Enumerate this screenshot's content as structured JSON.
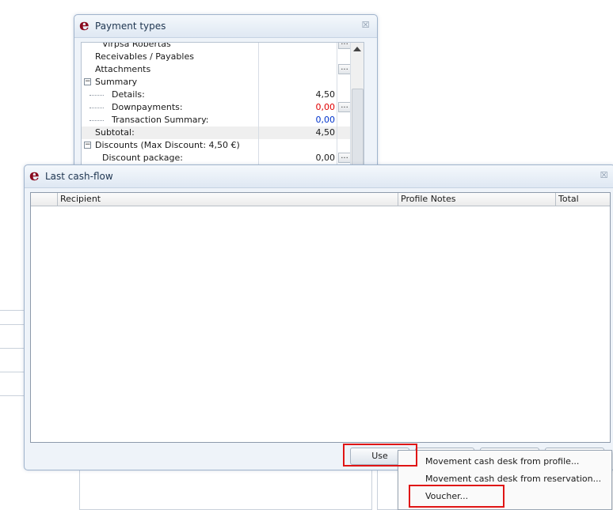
{
  "payment_window": {
    "title": "Payment types",
    "rows": [
      {
        "label": "Virpša Robertas",
        "value": "",
        "ellipsis": true
      },
      {
        "label": "Receivables / Payables",
        "value": "",
        "ellipsis": false
      },
      {
        "label": "Attachments",
        "value": "",
        "ellipsis": true
      },
      {
        "label": "Summary",
        "value": "",
        "ellipsis": false
      },
      {
        "label": "Details:",
        "value": "4,50",
        "ellipsis": false
      },
      {
        "label": "Downpayments:",
        "value": "0,00",
        "ellipsis": true,
        "color": "#e00000"
      },
      {
        "label": "Transaction Summary:",
        "value": "0,00",
        "ellipsis": false,
        "color": "#0033cc"
      },
      {
        "label": "Subtotal:",
        "value": "4,50",
        "ellipsis": false
      },
      {
        "label": "Discounts (Max Discount: 4,50 €)",
        "value": "",
        "ellipsis": false
      },
      {
        "label": "Discount package:",
        "value": "0,00",
        "ellipsis": true
      }
    ]
  },
  "cashflow_window": {
    "title": "Last cash-flow",
    "columns": [
      "Recipient",
      "Profile Notes",
      "Total"
    ],
    "use_button": "Use"
  },
  "context_menu": {
    "items": [
      "Movement cash desk from profile...",
      "Movement cash desk from reservation...",
      "Voucher..."
    ]
  },
  "ellipsis_label": "..."
}
